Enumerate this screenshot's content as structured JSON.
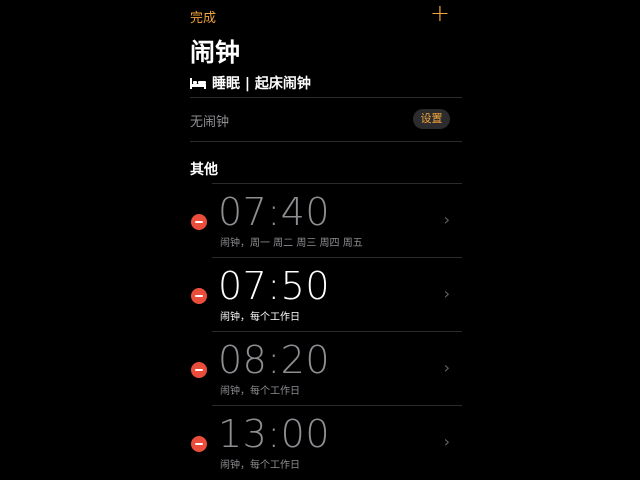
{
  "nav": {
    "done_label": "完成",
    "add_label": "+"
  },
  "title": "闹钟",
  "sleep_section": {
    "title": "睡眠 | 起床闹钟",
    "icon": "bed-icon",
    "no_alarm_label": "无闹钟",
    "settings_label": "设置"
  },
  "other_section": {
    "title": "其他"
  },
  "alarms": [
    {
      "time": "07:40",
      "label": "闹钟，周一 周二 周三 周四 周五",
      "enabled": false
    },
    {
      "time": "07:50",
      "label": "闹钟，每个工作日",
      "enabled": true
    },
    {
      "time": "08:20",
      "label": "闹钟，每个工作日",
      "enabled": false
    },
    {
      "time": "13:00",
      "label": "闹钟，每个工作日",
      "enabled": false
    }
  ],
  "colors": {
    "accent": "#f2a33a",
    "delete": "#eb4d3d",
    "background": "#000000"
  }
}
